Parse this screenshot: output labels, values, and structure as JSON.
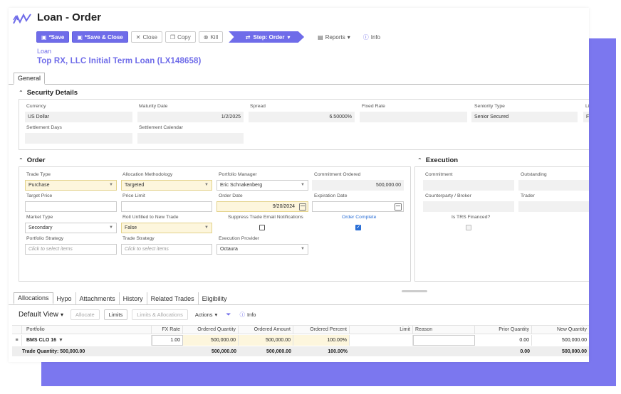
{
  "header": {
    "title": "Loan - Order",
    "breadcrumb": "Loan",
    "record_title": "Top RX, LLC Initial Term Loan (LX148658)"
  },
  "toolbar": {
    "save": "*Save",
    "save_close": "*Save & Close",
    "close": "Close",
    "copy": "Copy",
    "kill": "Kill",
    "step": "Step: Order",
    "reports": "Reports",
    "info": "Info"
  },
  "tabs_top": [
    "General"
  ],
  "security": {
    "title": "Security Details",
    "currency_label": "Currency",
    "currency": "US Dollar",
    "maturity_label": "Maturity Date",
    "maturity": "1/2/2025",
    "spread_label": "Spread",
    "spread": "6.50000%",
    "fixed_rate_label": "Fixed Rate",
    "fixed_rate": "",
    "seniority_label": "Seniority Type",
    "seniority": "Senior Secured",
    "cutoff_label": "Li",
    "cutoff_value": "F",
    "settle_days_label": "Settlement Days",
    "settle_days": "",
    "settle_cal_label": "Settlement Calendar",
    "settle_cal": ""
  },
  "order": {
    "title": "Order",
    "trade_type_label": "Trade Type",
    "trade_type": "Purchase",
    "alloc_method_label": "Allocation Methodology",
    "alloc_method": "Targeted",
    "pm_label": "Portfolio Manager",
    "pm": "Eric Schnakenberg",
    "commit_ordered_label": "Commitment Ordered",
    "commit_ordered": "500,000.00",
    "target_price_label": "Target Price",
    "target_price": "",
    "price_limit_label": "Price Limit",
    "price_limit": "",
    "order_date_label": "Order Date",
    "order_date": "9/20/2024",
    "exp_date_label": "Expiration Date",
    "exp_date": "",
    "market_type_label": "Market Type",
    "market_type": "Secondary",
    "roll_label": "Roll Unfilled to New Trade",
    "roll": "False",
    "suppress_label": "Suppress Trade Email Notifications",
    "order_complete_label": "Order Complete",
    "strategy_label": "Portfolio Strategy",
    "strategy_ph": "Click to select items",
    "trade_strategy_label": "Trade Strategy",
    "trade_strategy_ph": "Click to select items",
    "exec_provider_label": "Execution Provider",
    "exec_provider": "Octaura"
  },
  "execution": {
    "title": "Execution",
    "commitment_label": "Commitment",
    "outstanding_label": "Outstanding",
    "counterparty_label": "Counterparty / Broker",
    "trader_label": "Trader",
    "trs_label": "Is TRS Financed?"
  },
  "tabs_bottom": [
    "Allocations",
    "Hypo",
    "Attachments",
    "History",
    "Related Trades",
    "Eligibility"
  ],
  "grid_toolbar": {
    "view": "Default View",
    "allocate": "Allocate",
    "limits": "Limits",
    "limits_alloc": "Limits & Allocations",
    "actions": "Actions",
    "info": "Info"
  },
  "grid": {
    "columns": [
      "Portfolio",
      "FX Rate",
      "Ordered Quantity",
      "Ordered Amount",
      "Ordered Percent",
      "Limit",
      "Reason",
      "Prior Quantity",
      "New Quantity"
    ],
    "row": [
      "BMS CLO 16",
      "1.00",
      "500,000.00",
      "500,000.00",
      "100.00%",
      "",
      "",
      "0.00",
      "500,000.00"
    ],
    "totals_label": "Trade Quantity: 500,000.00",
    "totals": [
      "",
      "500,000.00",
      "500,000.00",
      "100.00%",
      "",
      "",
      "0.00",
      "500,000.00"
    ]
  },
  "colors": {
    "accent": "#6f6ce9",
    "backdrop": "#7b77ef",
    "editable": "#fdf6dd"
  }
}
